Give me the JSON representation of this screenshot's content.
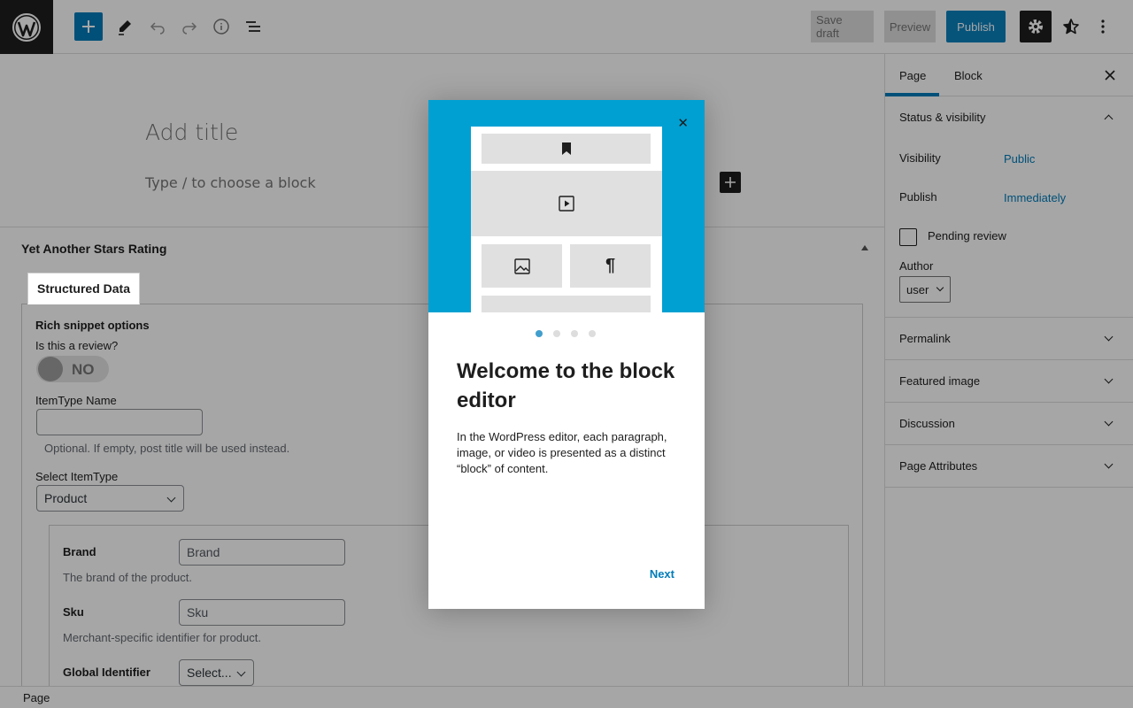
{
  "toolbar": {
    "save_draft": "Save draft",
    "preview": "Preview",
    "publish": "Publish"
  },
  "editor": {
    "title_placeholder": "Add title",
    "block_placeholder": "Type / to choose a block"
  },
  "metabox": {
    "title": "Yet Another Stars Rating",
    "tab": "Structured Data",
    "rich_snippet": "Rich snippet options",
    "is_review": "Is this a review?",
    "toggle_value": "NO",
    "itemtype_name_label": "ItemType Name",
    "itemtype_name_value": "",
    "optional_note": "Optional. If empty, post title will be used instead.",
    "select_itemtype_label": "Select ItemType",
    "select_itemtype_value": "Product",
    "fields": {
      "brand_label": "Brand",
      "brand_placeholder": "Brand",
      "brand_desc": "The brand of the product.",
      "sku_label": "Sku",
      "sku_placeholder": "Sku",
      "sku_desc": "Merchant-specific identifier for product.",
      "global_label": "Global Identifier",
      "global_value": "Select..."
    }
  },
  "sidebar": {
    "tabs": [
      "Page",
      "Block"
    ],
    "status": {
      "title": "Status & visibility",
      "visibility_label": "Visibility",
      "visibility_value": "Public",
      "publish_label": "Publish",
      "publish_value": "Immediately",
      "pending_review": "Pending review",
      "author_label": "Author",
      "author_value": "user"
    },
    "sections": [
      "Permalink",
      "Featured image",
      "Discussion",
      "Page Attributes"
    ]
  },
  "footer": {
    "breadcrumb": "Page"
  },
  "modal": {
    "heading": "Welcome to the block editor",
    "text": "In the WordPress editor, each paragraph, image, or video is presented as a distinct “block” of content.",
    "next": "Next",
    "pilcrow": "¶",
    "close_glyph": "✕",
    "page_count": 4,
    "current_page": 1
  },
  "colors": {
    "accent": "#007cba",
    "hero": "#00a0d2",
    "dark": "#1e1e1e"
  }
}
